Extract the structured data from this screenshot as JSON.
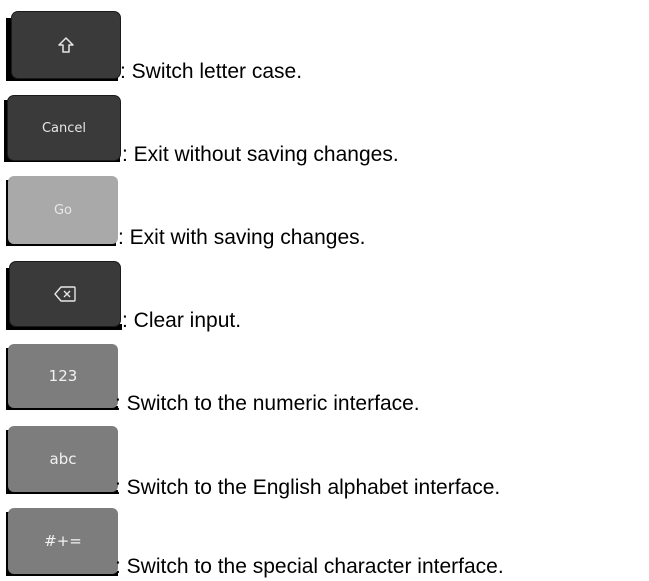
{
  "items": [
    {
      "key_label": "",
      "icon": "shift-arrow-icon",
      "description": ":  Switch letter case."
    },
    {
      "key_label": "Cancel",
      "icon": "",
      "description": ":  Exit without saving changes."
    },
    {
      "key_label": "Go",
      "icon": "",
      "description": ":  Exit with saving changes."
    },
    {
      "key_label": "",
      "icon": "backspace-icon",
      "description": ":  Clear input."
    },
    {
      "key_label": "123",
      "icon": "",
      "description": ":  Switch to the numeric interface."
    },
    {
      "key_label": "abc",
      "icon": "",
      "description": ":  Switch to the English alphabet interface."
    },
    {
      "key_label": "#+=",
      "icon": "",
      "description": ":  Switch to the special character interface."
    }
  ]
}
